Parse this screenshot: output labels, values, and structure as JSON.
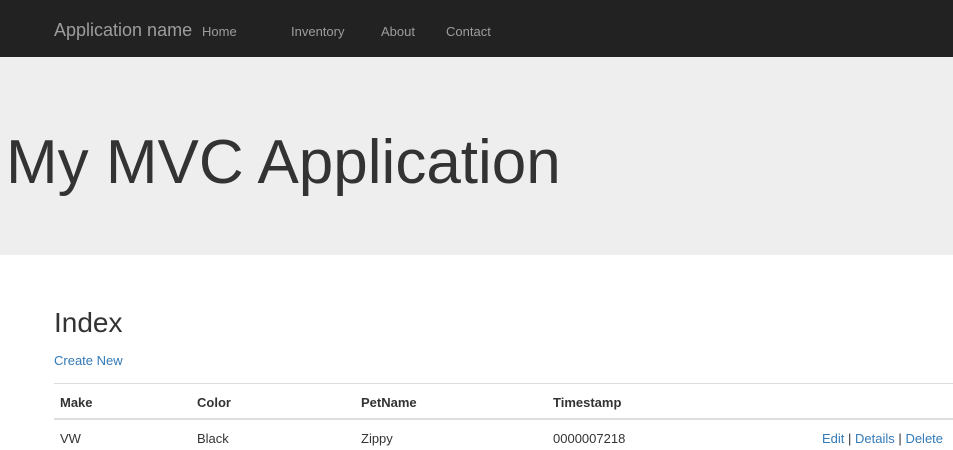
{
  "navbar": {
    "brand": "Application name",
    "links": [
      "Home",
      "Inventory",
      "About",
      "Contact"
    ],
    "background": "#222222",
    "text_color": "#9d9d9d"
  },
  "jumbotron": {
    "title": "My MVC Application",
    "background": "#eeeeee"
  },
  "page": {
    "heading": "Index",
    "create_link": "Create New",
    "link_color": "#337ab7"
  },
  "table": {
    "columns": [
      "Make",
      "Color",
      "PetName",
      "Timestamp"
    ],
    "rows": [
      {
        "make": "VW",
        "color": "Black",
        "petname": "Zippy",
        "timestamp": "0000007218",
        "actions": [
          "Edit",
          "Details",
          "Delete"
        ],
        "separator": "|"
      }
    ]
  }
}
